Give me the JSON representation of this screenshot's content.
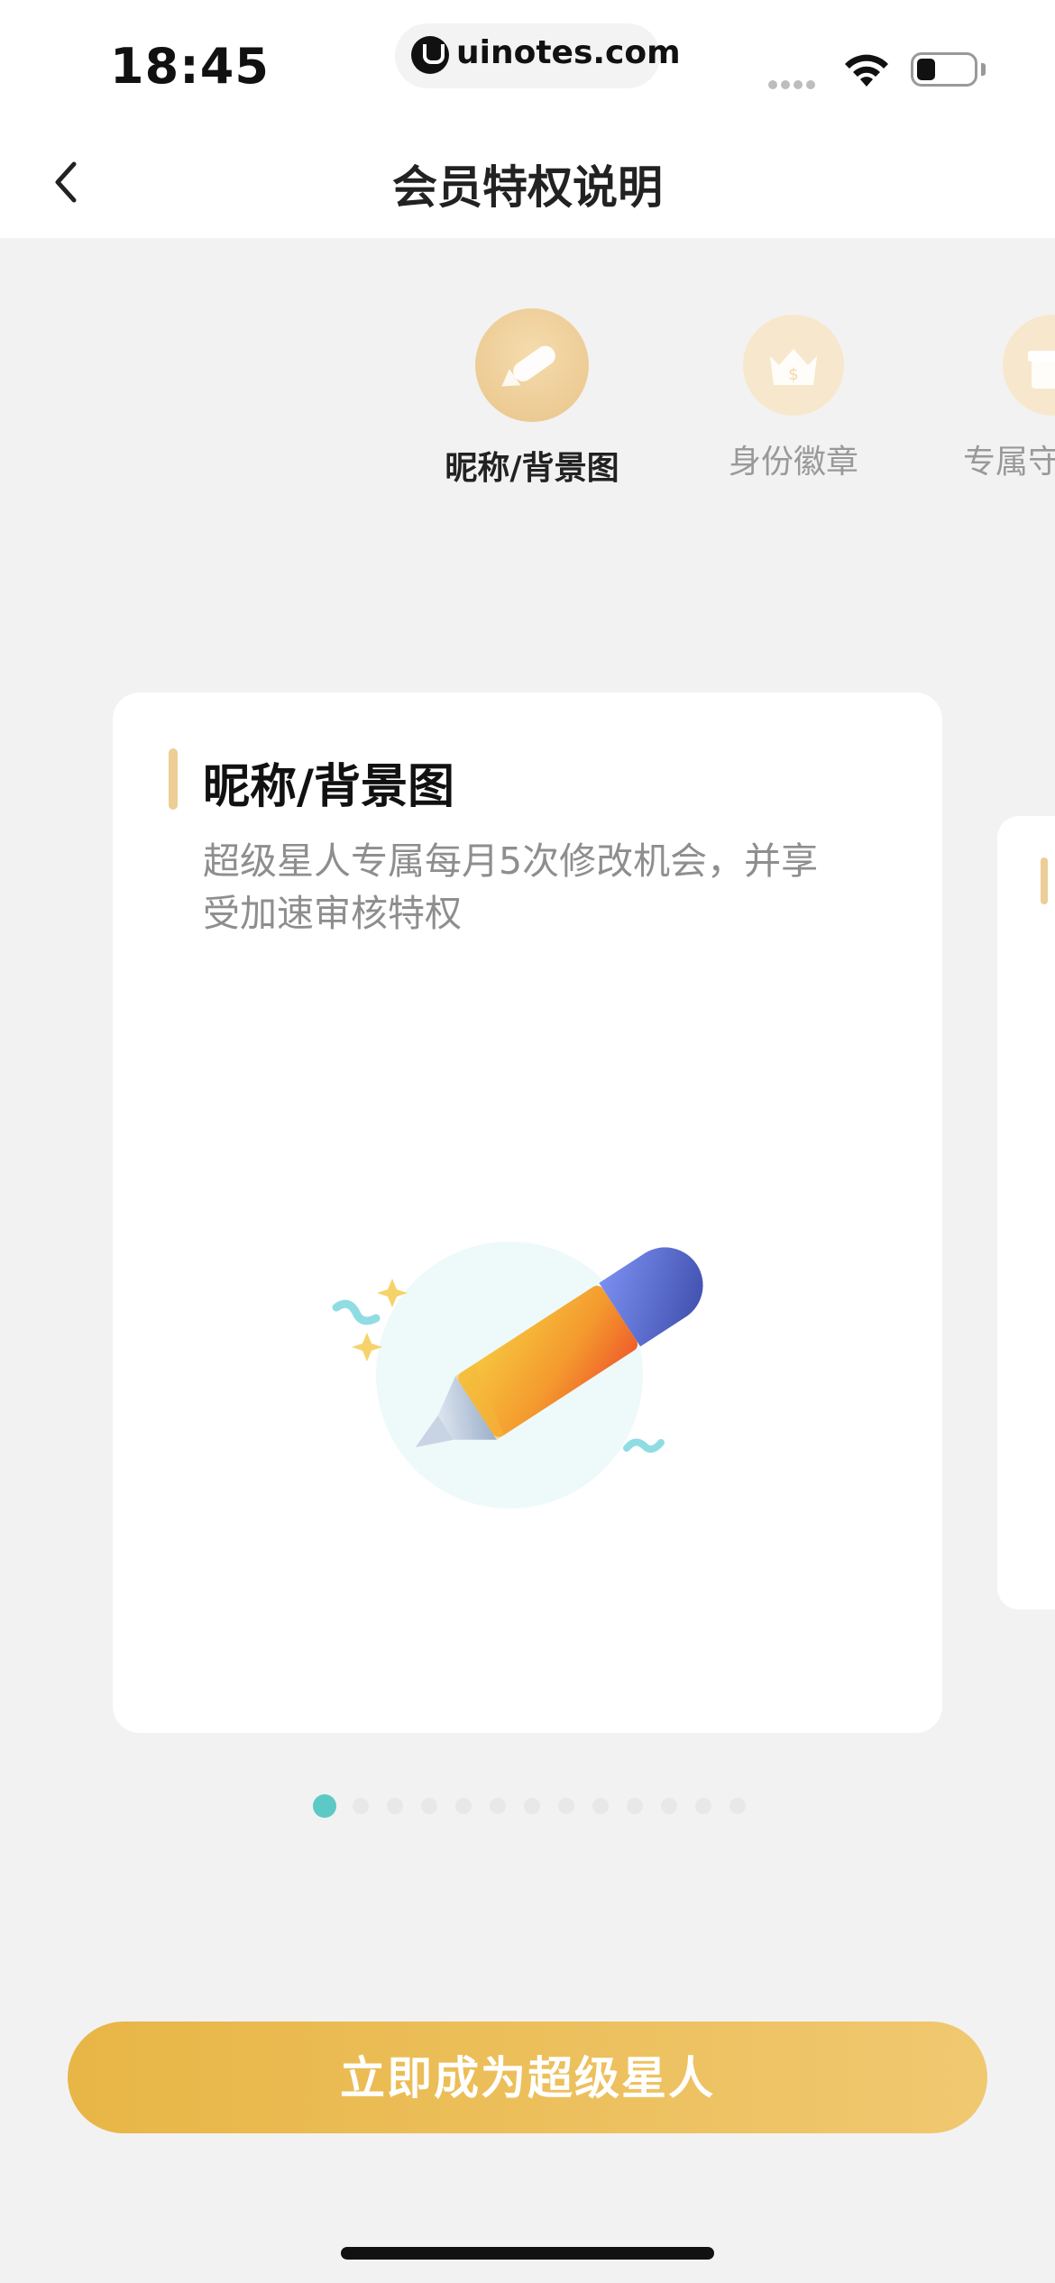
{
  "status_bar": {
    "time": "18:45",
    "url": "uinotes.com"
  },
  "nav": {
    "title": "会员特权说明",
    "back_icon": "chevron-left-icon"
  },
  "tabs": [
    {
      "label": "昵称/背景图",
      "icon": "pencil-icon",
      "active": true
    },
    {
      "label": "身份徽章",
      "icon": "crown-badge-icon",
      "active": false
    },
    {
      "label": "专属守护",
      "icon": "gift-icon",
      "active": false
    }
  ],
  "card": {
    "title": "昵称/背景图",
    "description": "超级星人专属每月5次修改机会，并享受加速审核特权",
    "illustration": "pencil-illustration"
  },
  "pagination": {
    "total": 13,
    "current": 1
  },
  "cta": {
    "label": "立即成为超级星人"
  },
  "colors": {
    "accent_gold": "#e8b646",
    "accent_gold_light": "#f0c870",
    "teal_dot": "#5cc9c4",
    "card_accent": "#ecce96"
  }
}
